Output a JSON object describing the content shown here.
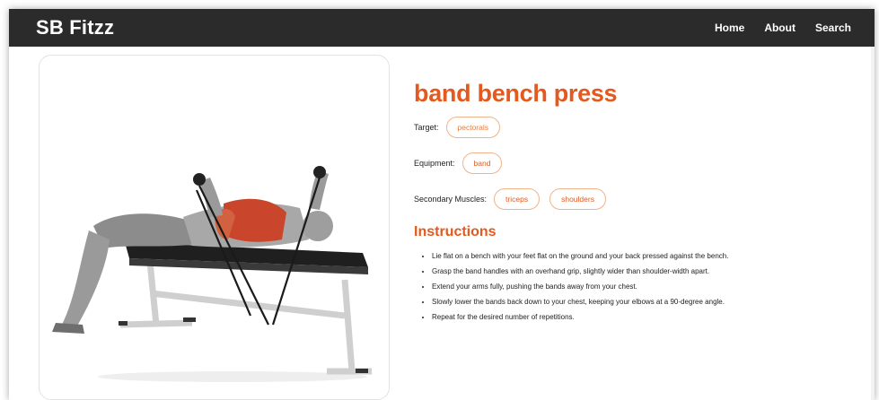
{
  "navbar": {
    "brand": "SB Fitzz",
    "links": [
      "Home",
      "About",
      "Search"
    ]
  },
  "exercise": {
    "name": "band bench press",
    "target_label": "Target:",
    "target": "pectorals",
    "equipment_label": "Equipment:",
    "equipment": "band",
    "secondary_label": "Secondary Muscles:",
    "secondary": [
      "triceps",
      "shoulders"
    ],
    "instructions_title": "Instructions",
    "instructions": [
      "Lie flat on a bench with your feet flat on the ground and your back pressed against the bench.",
      "Grasp the band handles with an overhand grip, slightly wider than shoulder-width apart.",
      "Extend your arms fully, pushing the bands away from your chest.",
      "Slowly lower the bands back down to your chest, keeping your elbows at a 90-degree angle.",
      "Repeat for the desired number of repetitions."
    ]
  },
  "colors": {
    "accent": "#e3591e",
    "navbar_bg": "#2b2b2b",
    "chip_border": "#f0b38a",
    "muscle_highlight": "#c9452b"
  }
}
